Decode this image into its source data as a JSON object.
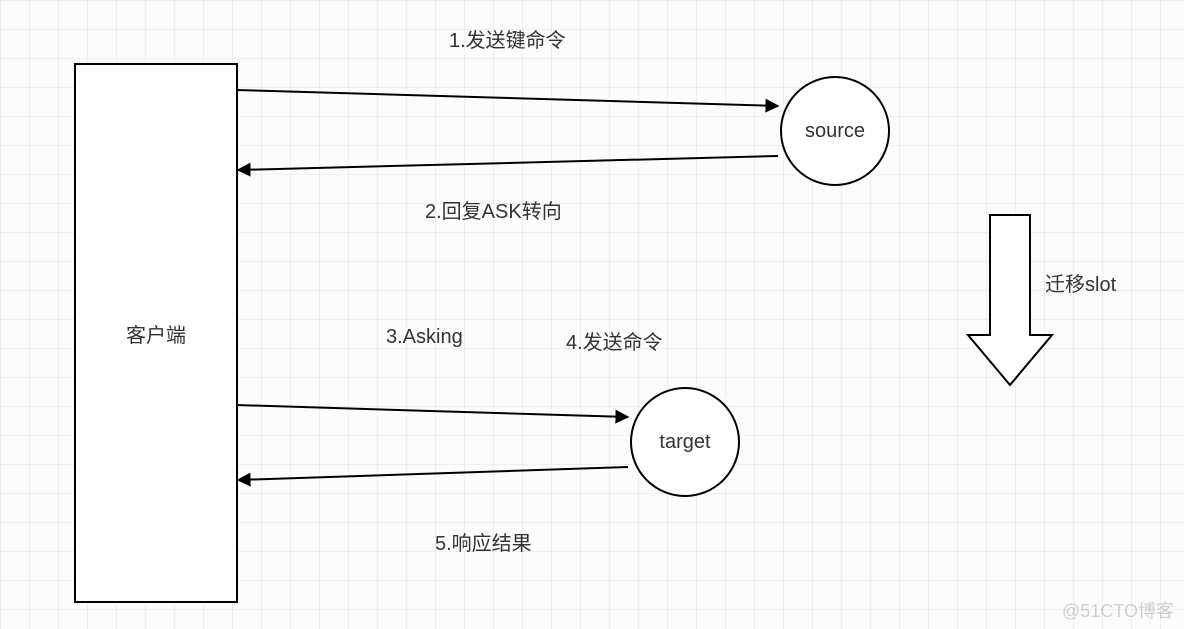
{
  "client": {
    "label": "客户端"
  },
  "source": {
    "label": "source"
  },
  "target": {
    "label": "target"
  },
  "migrate": {
    "label": "迁移slot"
  },
  "steps": {
    "s1": "1.发送键命令",
    "s2": "2.回复ASK转向",
    "s3": "3.Asking",
    "s4": "4.发送命令",
    "s5": "5.响应结果"
  },
  "watermark": "@51CTO博客"
}
